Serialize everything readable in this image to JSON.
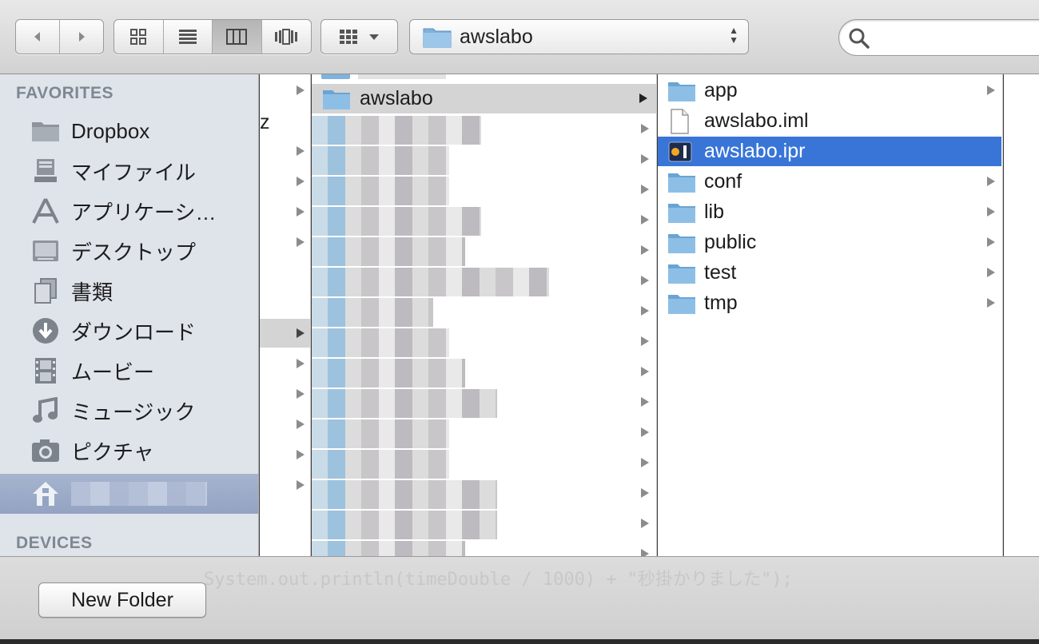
{
  "toolbar": {
    "path_label": "awslabo",
    "search_placeholder": ""
  },
  "sidebar": {
    "favorites_heading": "FAVORITES",
    "devices_heading": "DEVICES",
    "items": [
      {
        "label": "Dropbox",
        "icon": "folder-icon"
      },
      {
        "label": "マイファイル",
        "icon": "all-my-files-icon"
      },
      {
        "label": "アプリケーシ…",
        "icon": "applications-icon"
      },
      {
        "label": "デスクトップ",
        "icon": "desktop-icon"
      },
      {
        "label": "書類",
        "icon": "documents-icon"
      },
      {
        "label": "ダウンロード",
        "icon": "downloads-icon"
      },
      {
        "label": "ムービー",
        "icon": "movies-icon"
      },
      {
        "label": "ミュージック",
        "icon": "music-icon"
      },
      {
        "label": "ピクチャ",
        "icon": "pictures-icon"
      },
      {
        "label": "",
        "icon": "home-icon",
        "selected": true
      }
    ]
  },
  "columns": {
    "col1_partial_text": "z",
    "col2_selected": "awslabo",
    "col3_items": [
      {
        "label": "app",
        "type": "folder"
      },
      {
        "label": "awslabo.iml",
        "type": "file"
      },
      {
        "label": "awslabo.ipr",
        "type": "intellij",
        "selected": true
      },
      {
        "label": "conf",
        "type": "folder"
      },
      {
        "label": "lib",
        "type": "folder"
      },
      {
        "label": "public",
        "type": "folder"
      },
      {
        "label": "test",
        "type": "folder"
      },
      {
        "label": "tmp",
        "type": "folder"
      }
    ]
  },
  "bottom": {
    "new_folder_label": "New Folder"
  },
  "colors": {
    "selection": "#3875d7",
    "sidebar_bg": "#dfe4eb",
    "folder_blue": "#7fb2dc"
  }
}
